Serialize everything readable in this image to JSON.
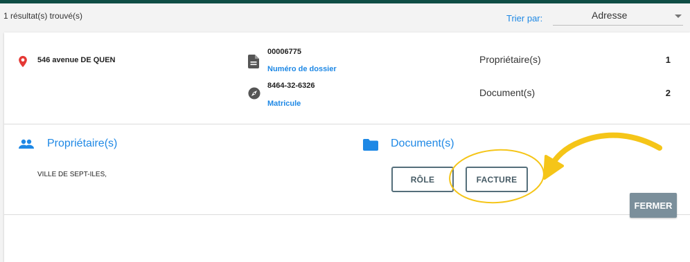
{
  "header": {
    "results_count": "1 résultat(s) trouvé(s)",
    "sort_label": "Trier par:",
    "sort_value": "Adresse"
  },
  "property": {
    "address": "546 avenue DE QUEN",
    "file_number": "00006775",
    "file_number_label": "Numéro de dossier",
    "matricule": "8464-32-6326",
    "matricule_label": "Matricule",
    "owners_label": "Propriétaire(s)",
    "owners_count": "1",
    "documents_label": "Document(s)",
    "documents_count": "2"
  },
  "owners_section": {
    "title": "Propriétaire(s)",
    "owners": [
      "VILLE DE SEPT-ILES,"
    ]
  },
  "documents_section": {
    "title": "Document(s)",
    "role_button": "RÔLE",
    "invoice_button": "FACTURE"
  },
  "footer": {
    "close_button": "FERMER"
  },
  "colors": {
    "accent": "#1e88e5",
    "pin": "#e53935",
    "top_bar": "#0f4d45",
    "annotation": "#f5c518",
    "close_button": "#7b8f9b"
  }
}
